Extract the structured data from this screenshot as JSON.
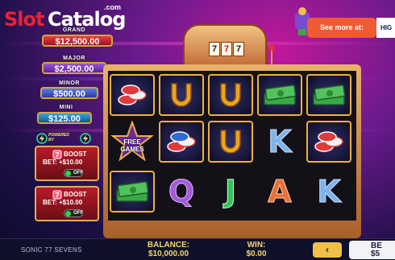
{
  "logo": {
    "part1": "Slot",
    "part2": "Catalog",
    "suffix": ".com"
  },
  "jackpots": [
    {
      "label": "GRAND",
      "value": "$12,500.00"
    },
    {
      "label": "MAJOR",
      "value": "$2,500.00"
    },
    {
      "label": "MINOR",
      "value": "$500.00"
    },
    {
      "label": "MINI",
      "value": "$125.00"
    }
  ],
  "powered_by": {
    "line1": "POWERED",
    "line2": "BY"
  },
  "boosts": [
    {
      "title": "BOOST",
      "bet": "BET: +$10.00",
      "toggle": "OFF"
    },
    {
      "title": "BOOST",
      "bet": "BET: +$10.00",
      "toggle": "OFF"
    }
  ],
  "machine": {
    "top_reels": [
      "7",
      "7",
      "7"
    ]
  },
  "free_games": {
    "line1": "FREE",
    "line2": "GAMES"
  },
  "reels": {
    "row1": [
      "chips",
      "horseshoe",
      "horseshoe",
      "cash",
      "cash"
    ],
    "row2": [
      "free-games-star",
      "chips",
      "horseshoe",
      "K",
      "chips"
    ],
    "row3": [
      "cash",
      "Q",
      "J",
      "A",
      "K"
    ]
  },
  "banner": {
    "see_more": "See more at:",
    "partner": "HIG"
  },
  "bottom_bar": {
    "game_name": "SONIC 77 SEVENS",
    "balance_label": "BALANCE:",
    "balance_value": "$10,000.00",
    "win_label": "WIN:",
    "win_value": "$0.00",
    "prev_button": "‹",
    "bet_label": "BE",
    "bet_value": "$5"
  },
  "colors": {
    "gold": "#f0b13a",
    "balance_text": "#f3d86d",
    "brand_red": "#e52535",
    "banner_orange": "#f05a33"
  }
}
